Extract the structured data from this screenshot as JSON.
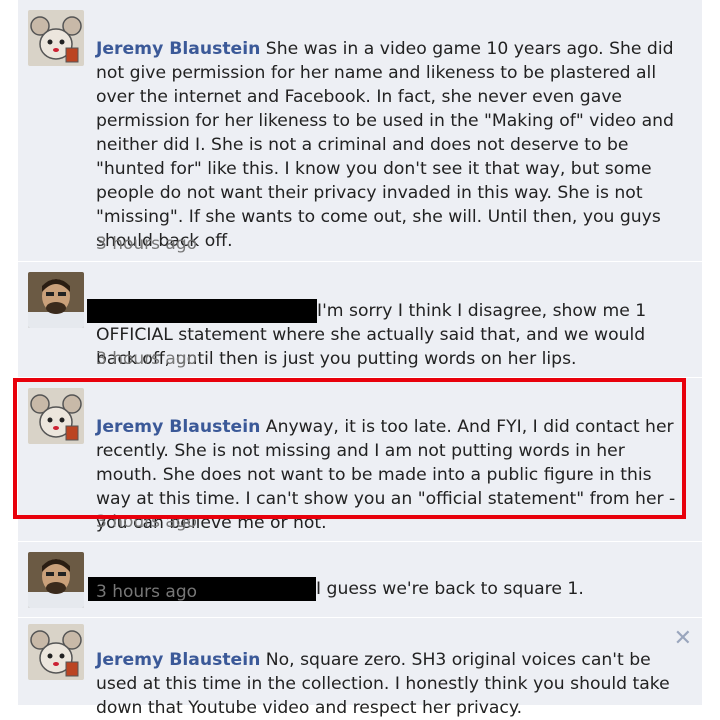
{
  "comments": [
    {
      "author": "Jeremy Blaustein",
      "text": " She was in a video game 10 years ago. She did\nnot give permission for her name and likeness to be plastered all\nover the internet and Facebook. In fact, she never even gave\npermission for her likeness to be used in the \"Making of\" video and\nneither did I. She is not a criminal and does not deserve to be\n\"hunted for\" like this. I know you don't see it that way, but some\npeople do not want their privacy invaded in this way. She is not\n\"missing\". If she wants to come out, she will. Until then, you guys\nshould back off.",
      "time": "3 hours ago"
    },
    {
      "author": "",
      "text": "I'm sorry I think I disagree, show me 1\nOFFICIAL statement where she actually said that, and we would\nback off, until then is just you putting words on her lips.",
      "time": "3 hours ago"
    },
    {
      "author": "Jeremy Blaustein",
      "text": " Anyway, it is too late. And FYI, I did contact her\nrecently. She is not missing and I am not putting words in her\nmouth. She does not want to be made into a public figure in this\nway at this time. I can't show you an \"official statement\" from her -\nyou can believe me or not.",
      "time": "3 hours ago"
    },
    {
      "author": "",
      "text": "I guess we're back to square 1.",
      "time": "3 hours ago"
    },
    {
      "author": "Jeremy Blaustein",
      "text": " No, square zero. SH3 original voices can't be\nused at this time in the collection. I honestly think you should take\ndown that Youtube video and respect her privacy.",
      "time": ""
    }
  ],
  "icons": {
    "remove": "close-icon",
    "avatar_mouse": "mouse-avatar-icon",
    "avatar_person": "person-avatar-icon"
  },
  "colors": {
    "author_link": "#3b5998",
    "thread_bg": "#edeff4",
    "highlight": "#e8000b",
    "redaction": "#000000"
  },
  "close_glyph": "✕"
}
